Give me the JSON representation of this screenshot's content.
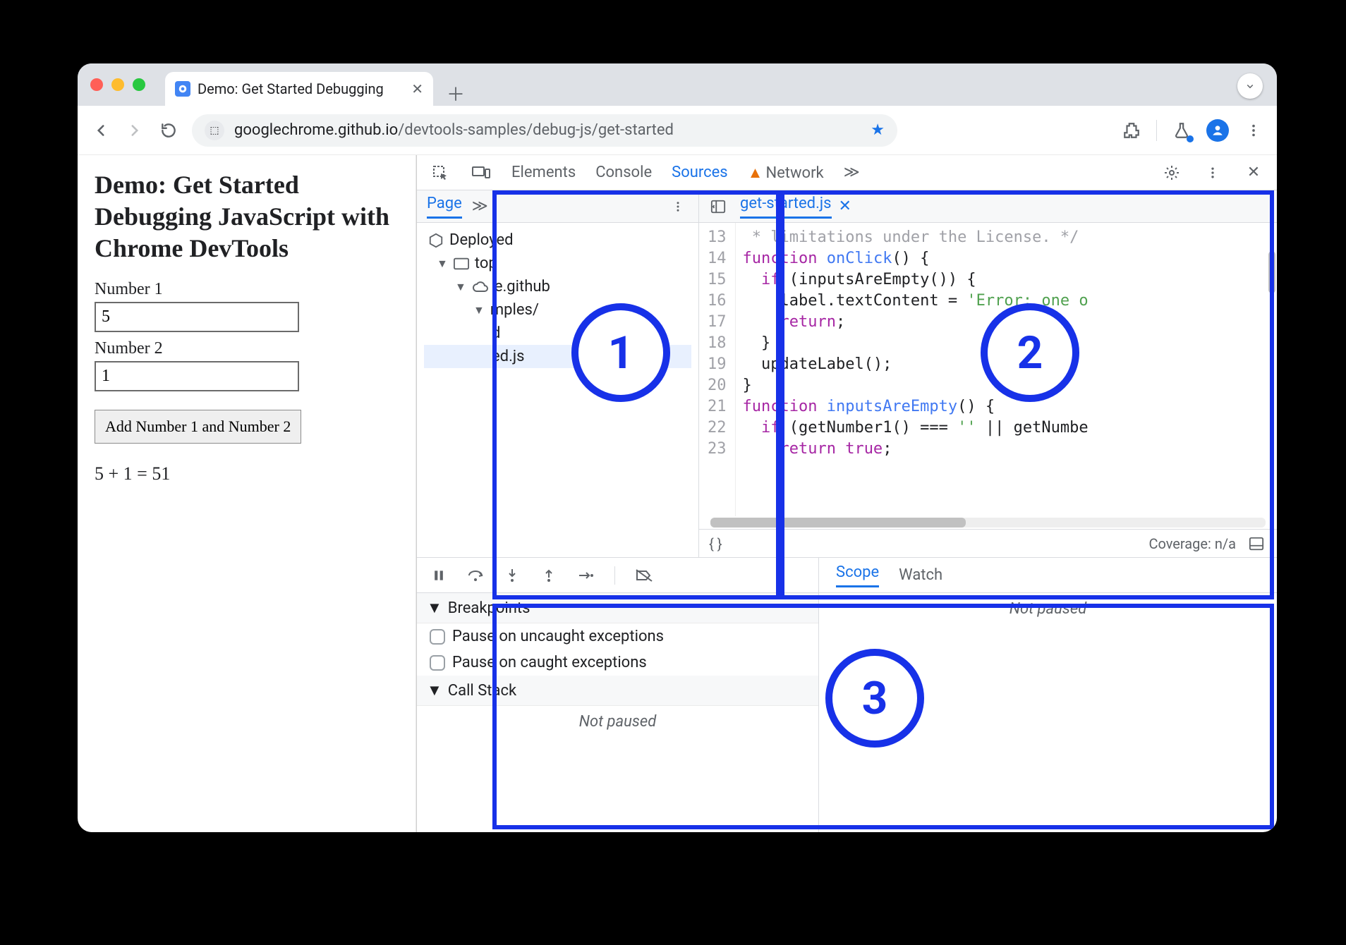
{
  "browser": {
    "tab_title": "Demo: Get Started Debugging",
    "url_host": "googlechrome.github.io",
    "url_path": "/devtools-samples/debug-js/get-started"
  },
  "page": {
    "heading": "Demo: Get Started Debugging JavaScript with Chrome DevTools",
    "num1_label": "Number 1",
    "num1_value": "5",
    "num2_label": "Number 2",
    "num2_value": "1",
    "add_button": "Add Number 1 and Number 2",
    "result": "5 + 1 = 51"
  },
  "devtools": {
    "tabs": {
      "elements": "Elements",
      "console": "Console",
      "sources": "Sources",
      "network": "Network"
    },
    "nav": {
      "page_tab": "Page",
      "deployed": "Deployed",
      "top": "top",
      "origin": "e.github",
      "folder": "mples/",
      "file_short": "d",
      "selected_file": "ed.js"
    },
    "editor": {
      "open_file": "get-started.js",
      "coverage": "Coverage: n/a",
      "lines": {
        "start": 13,
        "end": 23
      },
      "code": {
        "13": " * limitations under the License. */",
        "14": "function onClick() {",
        "15": "  if (inputsAreEmpty()) {",
        "16": "    label.textContent = 'Error: one o",
        "17": "    return;",
        "18": "  }",
        "19": "  updateLabel();",
        "20": "}",
        "21": "function inputsAreEmpty() {",
        "22": "  if (getNumber1() === '' || getNumbe",
        "23": "    return true;"
      }
    },
    "debugger": {
      "breakpoints_h": "Breakpoints",
      "bp_uncaught": "Pause on uncaught exceptions",
      "bp_caught": "Pause on caught exceptions",
      "callstack_h": "Call Stack",
      "not_paused": "Not paused",
      "scope_tab": "Scope",
      "watch_tab": "Watch"
    }
  },
  "annotations": {
    "one": "1",
    "two": "2",
    "three": "3"
  }
}
